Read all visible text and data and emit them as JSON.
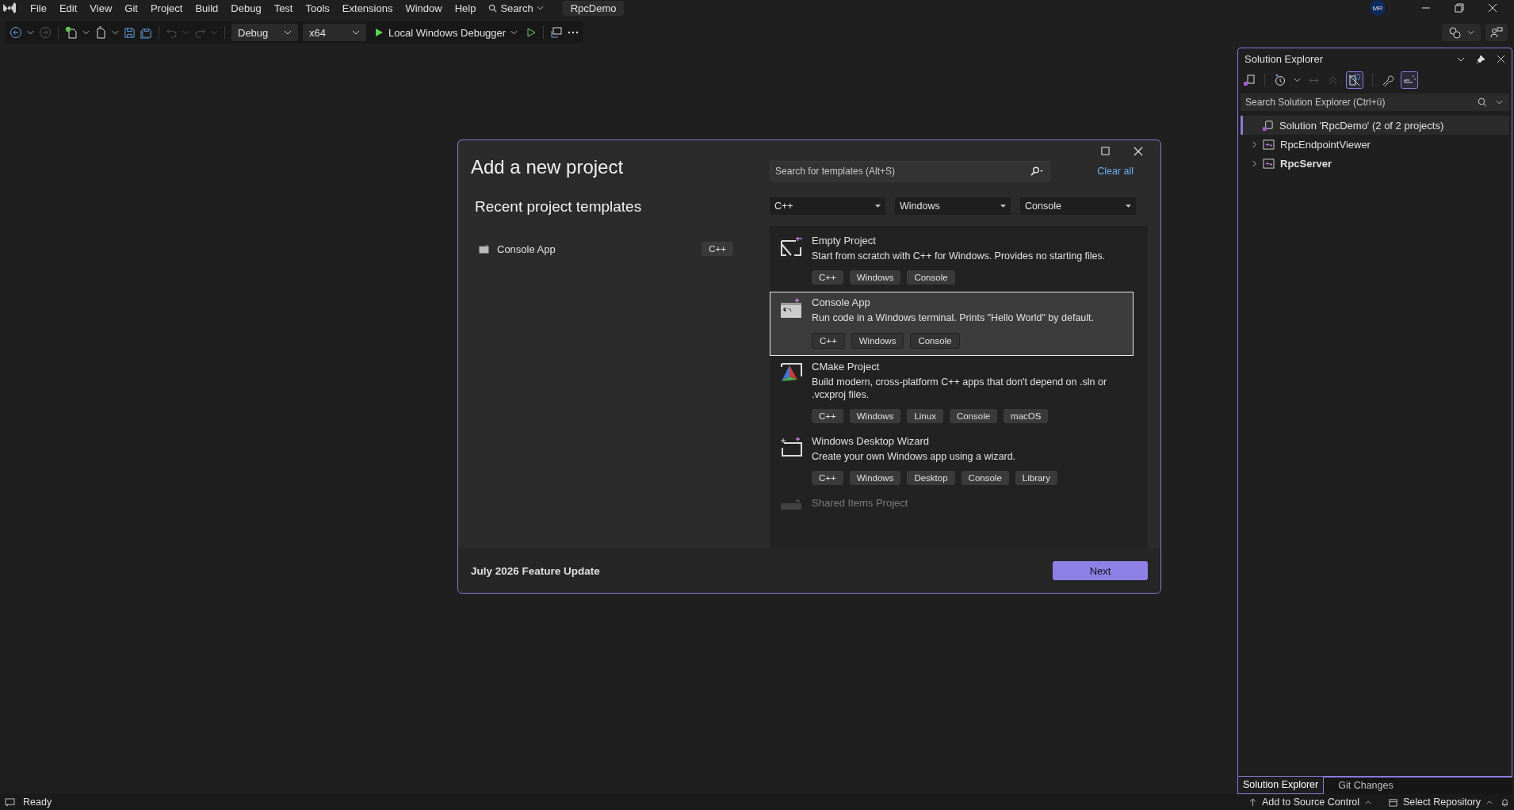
{
  "menu": {
    "items": [
      "File",
      "Edit",
      "View",
      "Git",
      "Project",
      "Build",
      "Debug",
      "Test",
      "Tools",
      "Extensions",
      "Window",
      "Help"
    ],
    "search": "Search",
    "solution_name": "RpcDemo",
    "avatar": "MR"
  },
  "toolbar": {
    "configuration": "Debug",
    "platform": "x64",
    "run_target": "Local Windows Debugger"
  },
  "dialog": {
    "title": "Add a new project",
    "recent_heading": "Recent project templates",
    "recent": [
      {
        "name": "Console App",
        "tag": "C++"
      }
    ],
    "search": {
      "placeholder": "Search for templates (Alt+S)"
    },
    "clear_all": "Clear all",
    "filters": [
      "C++",
      "Windows",
      "Console"
    ],
    "templates": [
      {
        "kind": "empty",
        "name": "Empty Project",
        "description": "Start from scratch with C++ for Windows. Provides no starting files.",
        "tags": [
          "C++",
          "Windows",
          "Console"
        ],
        "selected": false
      },
      {
        "kind": "console",
        "name": "Console App",
        "description": "Run code in a Windows terminal. Prints \"Hello World\" by default.",
        "tags": [
          "C++",
          "Windows",
          "Console"
        ],
        "selected": true
      },
      {
        "kind": "cmake",
        "name": "CMake Project",
        "description": "Build modern, cross-platform C++ apps that don't depend on .sln or .vcxproj files.",
        "tags": [
          "C++",
          "Windows",
          "Linux",
          "Console",
          "macOS"
        ],
        "selected": false
      },
      {
        "kind": "wizard",
        "name": "Windows Desktop Wizard",
        "description": "Create your own Windows app using a wizard.",
        "tags": [
          "C++",
          "Windows",
          "Desktop",
          "Console",
          "Library"
        ],
        "selected": false
      },
      {
        "kind": "shared",
        "name": "Shared Items Project",
        "selected": false
      }
    ],
    "footer_note": "July 2026 Feature Update",
    "next": "Next"
  },
  "solution_explorer": {
    "title": "Solution Explorer",
    "search": {
      "placeholder": "Search Solution Explorer (Ctrl+ü)"
    },
    "tree": [
      {
        "label": "Solution 'RpcDemo' (2 of 2 projects)",
        "selected": true,
        "children": [
          {
            "label": "RpcEndpointViewer",
            "expanded": false,
            "startup": false,
            "selected": false
          },
          {
            "label": "RpcServer",
            "expanded": false,
            "startup": true,
            "selected": false
          }
        ]
      }
    ],
    "tabs": [
      {
        "label": "Solution Explorer",
        "selected": true
      },
      {
        "label": "Git Changes",
        "selected": false
      }
    ]
  },
  "status_bar": {
    "state": "Ready",
    "add_to_source": "Add to Source Control",
    "repository": "Select Repository"
  }
}
